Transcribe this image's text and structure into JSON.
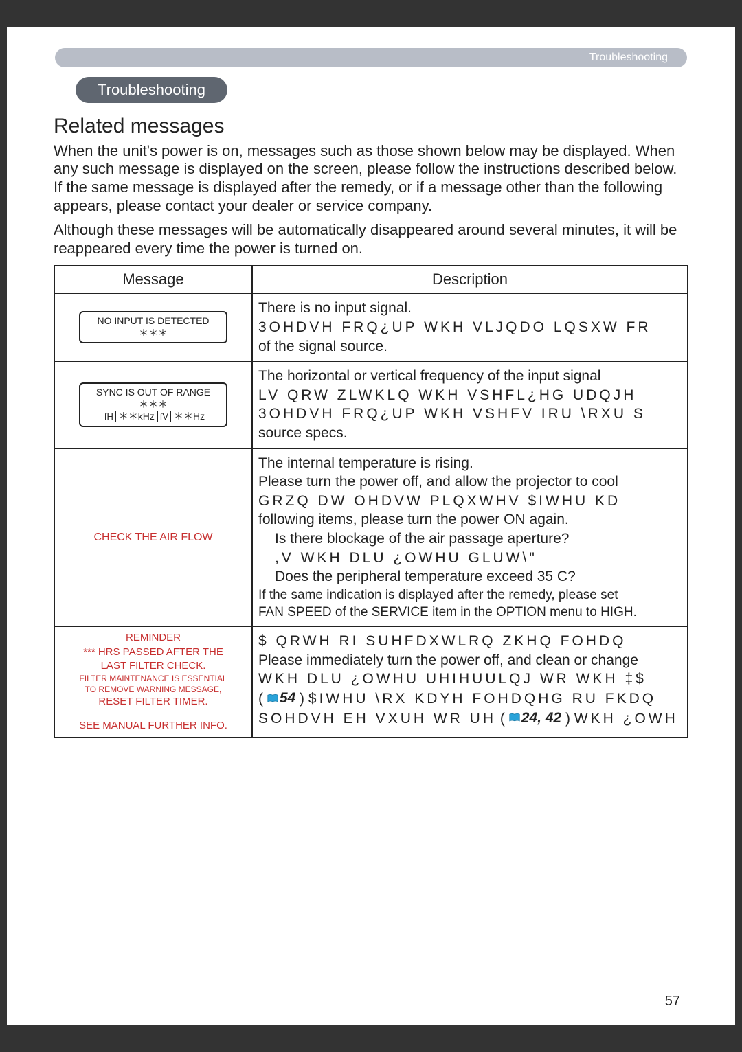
{
  "header": {
    "crumb": "Troubleshooting"
  },
  "pill": {
    "label": "Troubleshooting"
  },
  "title": "Related messages",
  "intro1": "When the unit's power is on, messages such as those shown below may be displayed. When any such message is displayed on the screen, please follow the instructions described below. If the same message is displayed after the remedy, or if a message other than the following appears, please contact your dealer or service company.",
  "intro2": "Although these messages will be automatically disappeared around several minutes, it will be reappeared every time the power is turned on.",
  "table": {
    "head": {
      "c1": "Message",
      "c2": "Description"
    },
    "rows": [
      {
        "msg": {
          "l1": "NO INPUT IS DETECTED",
          "l2": "＊＊＊"
        },
        "desc": {
          "l1": "There is no input signal.",
          "l2": "3OHDVH FRQ¿UP WKH VLJQDO LQSXW FR",
          "l3": "of the signal source."
        }
      },
      {
        "msg": {
          "l1": "SYNC IS OUT OF RANGE",
          "l2": "＊＊＊",
          "l3a": "fH",
          "l3b": "＊＊kHz",
          "l3c": "fV",
          "l3d": "＊＊Hz"
        },
        "desc": {
          "l1": "The horizontal or vertical frequency of the input signal",
          "l2": "LV QRW ZLWKLQ WKH VSHFL¿HG UDQJH",
          "l3": "3OHDVH FRQ¿UP WKH VSHFV IRU \\RXU S",
          "l4": "source specs."
        }
      },
      {
        "msg": {
          "l1": "CHECK THE AIR FLOW"
        },
        "desc": {
          "l1": "The internal temperature is rising.",
          "l2": "Please turn the power off, and allow the projector to cool",
          "l3": "GRZQ DW OHDVW    PLQXWHV  $IWHU KD",
          "l4": "following items, please turn the power ON again.",
          "l5": "Is there blockage of the air passage aperture?",
          "l6": ",V WKH DLU ¿OWHU GLUW\\\"",
          "l7": "Does the peripheral temperature exceed 35 C?",
          "l8": "If the same indication is displayed after the remedy, please set",
          "l9": "FAN SPEED of the SERVICE item in the OPTION menu to HIGH."
        }
      },
      {
        "msg": {
          "l1": "REMINDER",
          "l2": "*** HRS PASSED AFTER THE",
          "l3": "LAST FILTER CHECK.",
          "l4": "FILTER MAINTENANCE IS ESSENTIAL",
          "l5": "TO REMOVE WARNING MESSAGE,",
          "l6": "RESET FILTER TIMER.",
          "l7": "SEE MANUAL FURTHER INFO."
        },
        "desc": {
          "l1": "$ QRWH RI SUHFDXWLRQ ZKHQ FOHDQ",
          "l2": "Please immediately turn the power off, and clean or change",
          "l3": "WKH DLU ¿OWHU UHIHUULQJ WR WKH ‡$",
          "l4a": "54",
          "l4b": "  $IWHU \\RX KDYH FOHDQHG RU FKDQ",
          "l5a": "SOHDVH EH VXUH WR UH",
          "l5b": "24, 42",
          "l5c": " WKH ¿OWH"
        }
      }
    ]
  },
  "pagenum": "57"
}
